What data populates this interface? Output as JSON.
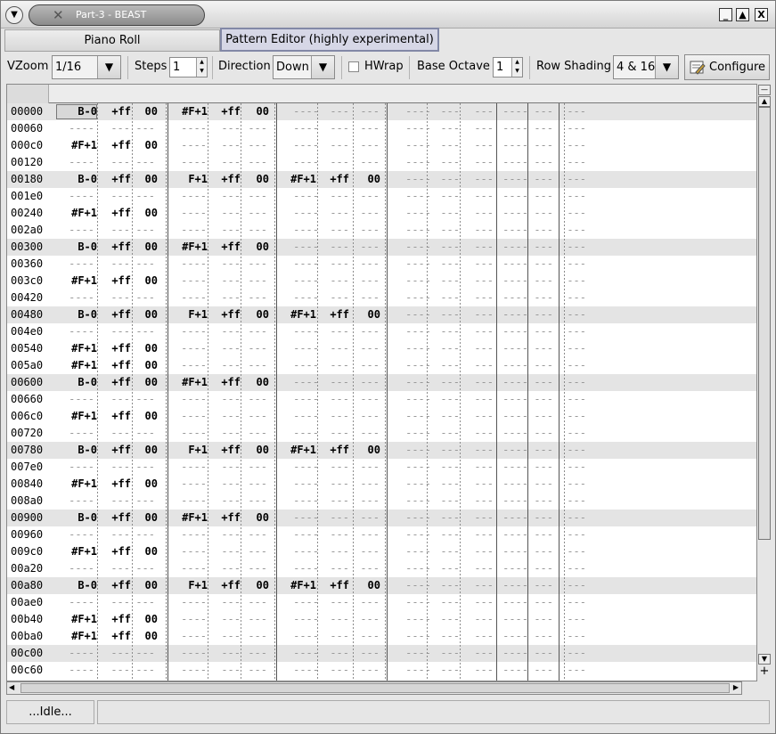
{
  "window": {
    "title": "Part-3 - BEAST",
    "buttons": [
      "_",
      "▲",
      "X"
    ]
  },
  "tabs": [
    {
      "label": "Piano Roll",
      "active": false
    },
    {
      "label": "Pattern Editor (highly experimental)",
      "active": true
    }
  ],
  "toolbar": {
    "vzoom_label": "VZoom",
    "vzoom_value": "1/16",
    "steps_label": "Steps",
    "steps_value": "1",
    "direction_label": "Direction",
    "direction_value": "Down",
    "hwrap_label": "HWrap",
    "hwrap_checked": false,
    "base_octave_label": "Base Octave",
    "base_octave_value": "1",
    "row_shading_label": "Row Shading",
    "row_shading_value": "4 & 16",
    "configure_label": "Configure"
  },
  "status": {
    "text": "...Idle...",
    "message": ""
  },
  "pattern": {
    "rows": [
      {
        "tick": "00000",
        "cells": [
          "B-0",
          "+ff",
          "00",
          "#F+1",
          "+ff",
          "00",
          "",
          "",
          ""
        ],
        "shade": true
      },
      {
        "tick": "00060",
        "cells": [
          "",
          "",
          "",
          "",
          "",
          "",
          "",
          "",
          ""
        ],
        "shade": false
      },
      {
        "tick": "000c0",
        "cells": [
          "#F+1",
          "+ff",
          "00",
          "",
          "",
          "",
          "",
          "",
          ""
        ],
        "shade": false
      },
      {
        "tick": "00120",
        "cells": [
          "",
          "",
          "",
          "",
          "",
          "",
          "",
          "",
          ""
        ],
        "shade": false
      },
      {
        "tick": "00180",
        "cells": [
          "B-0",
          "+ff",
          "00",
          "F+1",
          "+ff",
          "00",
          "#F+1",
          "+ff",
          "00"
        ],
        "shade": true
      },
      {
        "tick": "001e0",
        "cells": [
          "",
          "",
          "",
          "",
          "",
          "",
          "",
          "",
          ""
        ],
        "shade": false
      },
      {
        "tick": "00240",
        "cells": [
          "#F+1",
          "+ff",
          "00",
          "",
          "",
          "",
          "",
          "",
          ""
        ],
        "shade": false
      },
      {
        "tick": "002a0",
        "cells": [
          "",
          "",
          "",
          "",
          "",
          "",
          "",
          "",
          ""
        ],
        "shade": false
      },
      {
        "tick": "00300",
        "cells": [
          "B-0",
          "+ff",
          "00",
          "#F+1",
          "+ff",
          "00",
          "",
          "",
          ""
        ],
        "shade": true
      },
      {
        "tick": "00360",
        "cells": [
          "",
          "",
          "",
          "",
          "",
          "",
          "",
          "",
          ""
        ],
        "shade": false
      },
      {
        "tick": "003c0",
        "cells": [
          "#F+1",
          "+ff",
          "00",
          "",
          "",
          "",
          "",
          "",
          ""
        ],
        "shade": false
      },
      {
        "tick": "00420",
        "cells": [
          "",
          "",
          "",
          "",
          "",
          "",
          "",
          "",
          ""
        ],
        "shade": false
      },
      {
        "tick": "00480",
        "cells": [
          "B-0",
          "+ff",
          "00",
          "F+1",
          "+ff",
          "00",
          "#F+1",
          "+ff",
          "00"
        ],
        "shade": true
      },
      {
        "tick": "004e0",
        "cells": [
          "",
          "",
          "",
          "",
          "",
          "",
          "",
          "",
          ""
        ],
        "shade": false
      },
      {
        "tick": "00540",
        "cells": [
          "#F+1",
          "+ff",
          "00",
          "",
          "",
          "",
          "",
          "",
          ""
        ],
        "shade": false
      },
      {
        "tick": "005a0",
        "cells": [
          "#F+1",
          "+ff",
          "00",
          "",
          "",
          "",
          "",
          "",
          ""
        ],
        "shade": false
      },
      {
        "tick": "00600",
        "cells": [
          "B-0",
          "+ff",
          "00",
          "#F+1",
          "+ff",
          "00",
          "",
          "",
          ""
        ],
        "shade": true
      },
      {
        "tick": "00660",
        "cells": [
          "",
          "",
          "",
          "",
          "",
          "",
          "",
          "",
          ""
        ],
        "shade": false
      },
      {
        "tick": "006c0",
        "cells": [
          "#F+1",
          "+ff",
          "00",
          "",
          "",
          "",
          "",
          "",
          ""
        ],
        "shade": false
      },
      {
        "tick": "00720",
        "cells": [
          "",
          "",
          "",
          "",
          "",
          "",
          "",
          "",
          ""
        ],
        "shade": false
      },
      {
        "tick": "00780",
        "cells": [
          "B-0",
          "+ff",
          "00",
          "F+1",
          "+ff",
          "00",
          "#F+1",
          "+ff",
          "00"
        ],
        "shade": true
      },
      {
        "tick": "007e0",
        "cells": [
          "",
          "",
          "",
          "",
          "",
          "",
          "",
          "",
          ""
        ],
        "shade": false
      },
      {
        "tick": "00840",
        "cells": [
          "#F+1",
          "+ff",
          "00",
          "",
          "",
          "",
          "",
          "",
          ""
        ],
        "shade": false
      },
      {
        "tick": "008a0",
        "cells": [
          "",
          "",
          "",
          "",
          "",
          "",
          "",
          "",
          ""
        ],
        "shade": false
      },
      {
        "tick": "00900",
        "cells": [
          "B-0",
          "+ff",
          "00",
          "#F+1",
          "+ff",
          "00",
          "",
          "",
          ""
        ],
        "shade": true
      },
      {
        "tick": "00960",
        "cells": [
          "",
          "",
          "",
          "",
          "",
          "",
          "",
          "",
          ""
        ],
        "shade": false
      },
      {
        "tick": "009c0",
        "cells": [
          "#F+1",
          "+ff",
          "00",
          "",
          "",
          "",
          "",
          "",
          ""
        ],
        "shade": false
      },
      {
        "tick": "00a20",
        "cells": [
          "",
          "",
          "",
          "",
          "",
          "",
          "",
          "",
          ""
        ],
        "shade": false
      },
      {
        "tick": "00a80",
        "cells": [
          "B-0",
          "+ff",
          "00",
          "F+1",
          "+ff",
          "00",
          "#F+1",
          "+ff",
          "00"
        ],
        "shade": true
      },
      {
        "tick": "00ae0",
        "cells": [
          "",
          "",
          "",
          "",
          "",
          "",
          "",
          "",
          ""
        ],
        "shade": false
      },
      {
        "tick": "00b40",
        "cells": [
          "#F+1",
          "+ff",
          "00",
          "",
          "",
          "",
          "",
          "",
          ""
        ],
        "shade": false
      },
      {
        "tick": "00ba0",
        "cells": [
          "#F+1",
          "+ff",
          "00",
          "",
          "",
          "",
          "",
          "",
          ""
        ],
        "shade": false
      },
      {
        "tick": "00c00",
        "cells": [
          "",
          "",
          "",
          "",
          "",
          "",
          "",
          "",
          ""
        ],
        "shade": true
      },
      {
        "tick": "00c60",
        "cells": [
          "",
          "",
          "",
          "",
          "",
          "",
          "",
          "",
          ""
        ],
        "shade": false
      }
    ],
    "empty_note": "----",
    "empty_value": "---",
    "cursor_row": 0
  }
}
